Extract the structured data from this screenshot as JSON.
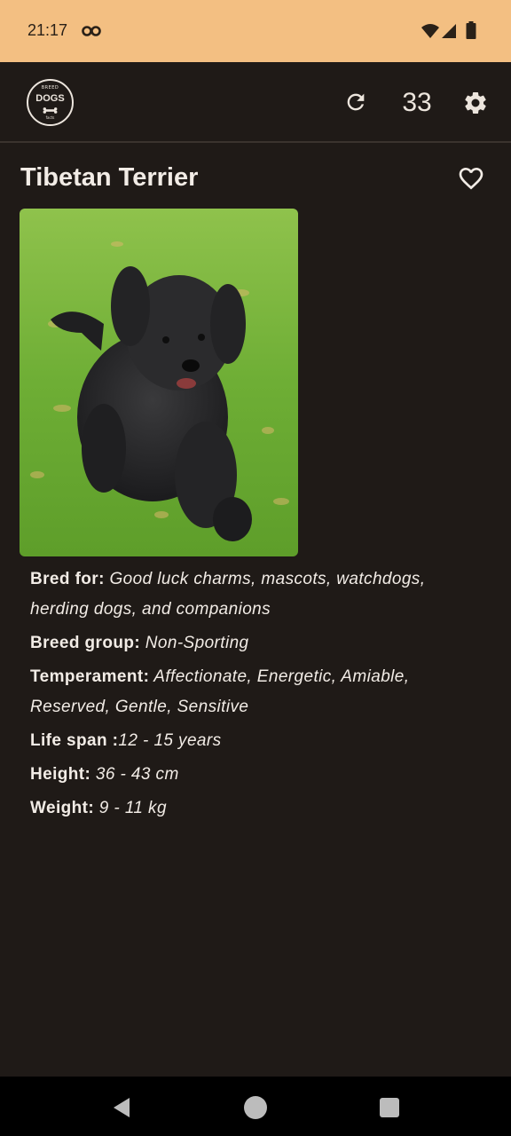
{
  "status_bar": {
    "time": "21:17",
    "icons": [
      "app-notification-icon",
      "wifi-icon",
      "cell-signal-icon",
      "battery-icon"
    ]
  },
  "app_bar": {
    "logo": {
      "top": "BREED",
      "main": "DOGS",
      "bottom": "facts"
    },
    "refresh_icon": "refresh-icon",
    "count": "33",
    "settings_icon": "gear-icon"
  },
  "breed": {
    "name": "Tibetan Terrier",
    "favorite_icon": "heart-outline-icon",
    "photo_subject": "black Tibetan Terrier running on grass"
  },
  "details": [
    {
      "label": "Bred for:",
      "value": " Good luck charms, mascots, watchdogs, herding dogs, and companions"
    },
    {
      "label": "Breed group:",
      "value": " Non-Sporting"
    },
    {
      "label": "Temperament:",
      "value": " Affectionate, Energetic, Amiable, Reserved, Gentle, Sensitive"
    },
    {
      "label": "Life span :",
      "value": "12 - 15 years"
    },
    {
      "label": "Height:",
      "value": " 36 - 43 cm"
    },
    {
      "label": "Weight:",
      "value": " 9 - 11 kg"
    }
  ],
  "nav_bar": {
    "icons": [
      "back-icon",
      "home-icon",
      "recents-icon"
    ]
  },
  "colors": {
    "status_bar": "#f3bf82",
    "background": "#1f1a17",
    "text": "#f2ece6",
    "nav_bar": "#000000"
  }
}
